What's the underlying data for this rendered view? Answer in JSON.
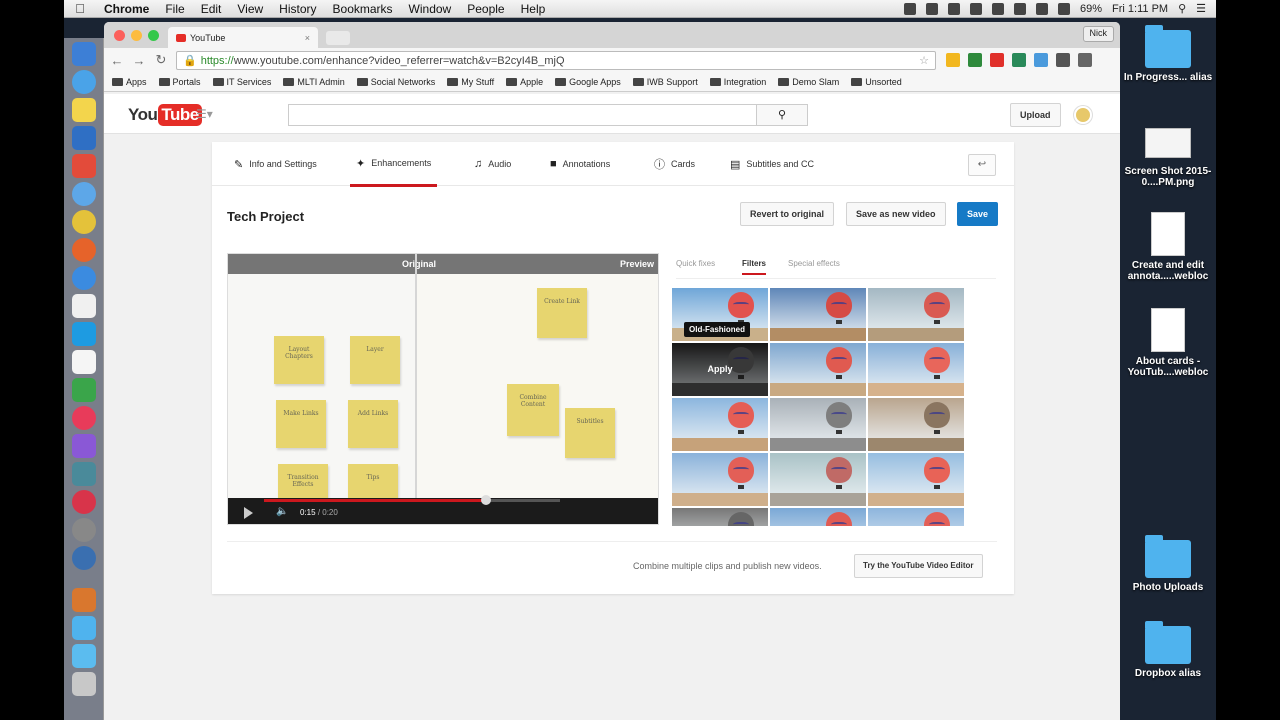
{
  "menubar": {
    "app_name": "Chrome",
    "items": [
      "File",
      "Edit",
      "View",
      "History",
      "Bookmarks",
      "Window",
      "People",
      "Help"
    ],
    "battery": "69%",
    "clock": "Fri 1:11 PM"
  },
  "browser": {
    "tab_title": "YouTube",
    "profile_name": "Nick",
    "url_https": "https://",
    "url_rest": "www.youtube.com/enhance?video_referrer=watch&v=B2cyI4B_mjQ",
    "bookmarks": [
      "Apps",
      "Portals",
      "IT Services",
      "MLTI Admin",
      "Social Networks",
      "My Stuff",
      "Apple",
      "Google Apps",
      "IWB Support",
      "Integration",
      "Demo Slam",
      "Unsorted"
    ]
  },
  "youtube": {
    "logo_you": "You",
    "logo_tube": "Tube",
    "search_icon": "search-icon",
    "upload_label": "Upload"
  },
  "editor": {
    "tabs": [
      {
        "label": "Info and Settings",
        "icon": "pencil-icon"
      },
      {
        "label": "Enhancements",
        "icon": "wand-icon"
      },
      {
        "label": "Audio",
        "icon": "music-icon"
      },
      {
        "label": "Annotations",
        "icon": "speech-icon"
      },
      {
        "label": "Cards",
        "icon": "info-icon"
      },
      {
        "label": "Subtitles and CC",
        "icon": "cc-icon"
      }
    ],
    "active_tab": "Enhancements",
    "project_title": "Tech Project",
    "revert_label": "Revert to original",
    "save_new_label": "Save as new video",
    "save_label": "Save"
  },
  "player": {
    "original_label": "Original",
    "preview_label": "Preview",
    "time_current": "0:15",
    "time_total": "/ 0:20",
    "progress": 0.75,
    "notes_left": [
      "Layout Chapters",
      "Layer",
      "Make Links",
      "Add Links",
      "Transition Effects",
      "Tips"
    ],
    "notes_right": [
      "Create Link",
      "Combine Content",
      "Subtitles"
    ]
  },
  "filters": {
    "tabs": [
      "Quick fixes",
      "Filters",
      "Special effects"
    ],
    "active_tab": "Filters",
    "tooltip": "Old-Fashioned",
    "apply_label": "Apply"
  },
  "footer": {
    "combine_text": "Combine multiple clips and publish new videos.",
    "try_editor_label": "Try the YouTube Video Editor"
  },
  "desktop": {
    "items": [
      "In Progress... alias",
      "Screen Shot 2015-0....PM.png",
      "Create and edit annota.....webloc",
      "About cards - YouTub....webloc",
      "Photo Uploads",
      "Dropbox alias"
    ]
  },
  "colors": {
    "accent_red": "#cc181e",
    "save_blue": "#167ac6",
    "youtube_red": "#e52d27"
  }
}
